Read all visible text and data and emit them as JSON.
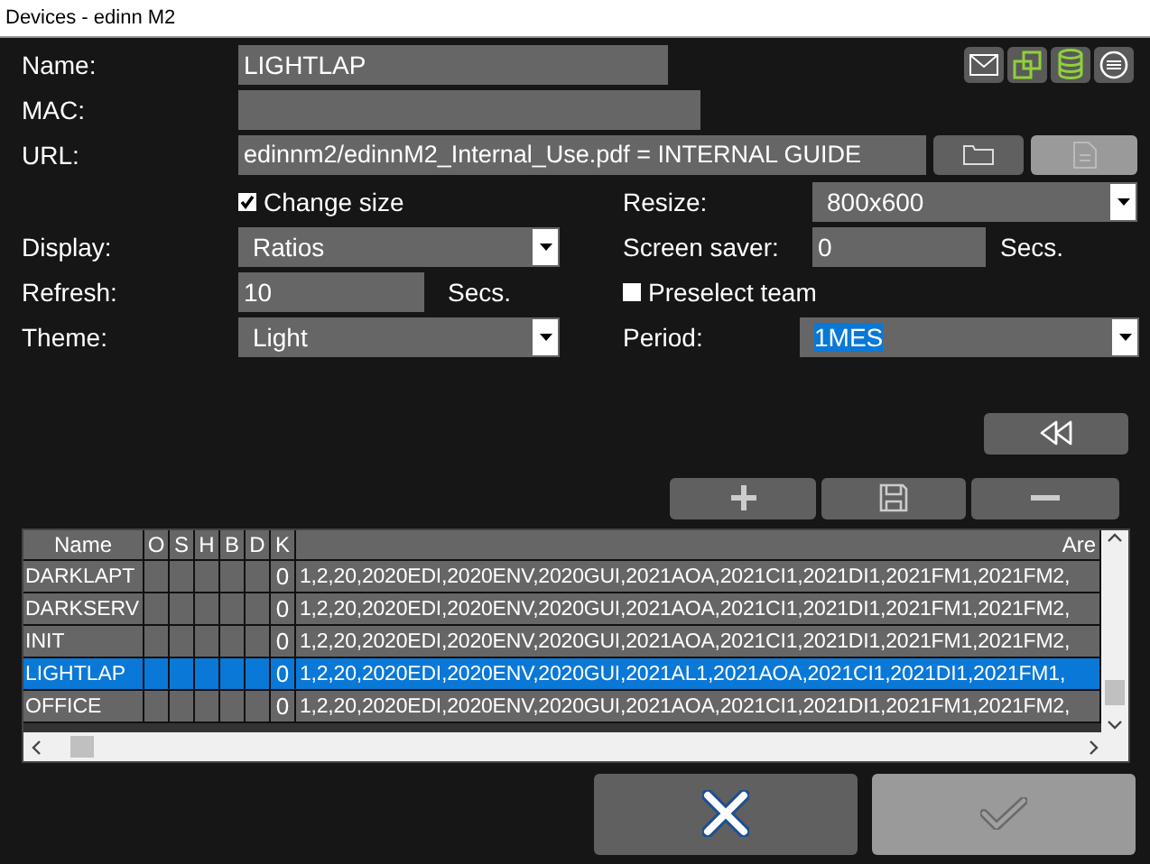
{
  "window": {
    "title": "Devices - edinn M2"
  },
  "form": {
    "name": {
      "label": "Name:",
      "value": "LIGHTLAP"
    },
    "mac": {
      "label": "MAC:"
    },
    "url": {
      "label": "URL:",
      "value": "edinnm2/edinnM2_Internal_Use.pdf = INTERNAL GUIDE"
    },
    "url_buttons": [
      {
        "kind": "folder",
        "disabled": false
      },
      {
        "kind": "document",
        "disabled": true
      }
    ],
    "change_size": {
      "label": "Change size",
      "checked": true
    },
    "resize": {
      "label": "Resize:",
      "value": "800x600"
    },
    "display": {
      "label": "Display:",
      "value": "Ratios"
    },
    "screen_saver": {
      "label": "Screen saver:",
      "value": "0",
      "unit": "Secs."
    },
    "refresh": {
      "label": "Refresh:",
      "value": "10",
      "unit": "Secs."
    },
    "preselect_team": {
      "label": "Preselect team",
      "checked": false
    },
    "theme": {
      "label": "Theme:",
      "value": "Light"
    },
    "period": {
      "label": "Period:",
      "value": "1MES",
      "highlighted": true
    }
  },
  "table": {
    "columns": [
      "Name",
      "O",
      "S",
      "H",
      "B",
      "D",
      "K",
      "Are"
    ],
    "rows": [
      {
        "cells": [
          "DARKLAPT",
          "",
          "",
          "",
          "",
          "",
          "0",
          "1,2,20,2020EDI,2020ENV,2020GUI,2021AOA,2021CI1,2021DI1,2021FM1,2021FM2,"
        ],
        "selected": false
      },
      {
        "cells": [
          "DARKSERV",
          "",
          "",
          "",
          "",
          "",
          "0",
          "1,2,20,2020EDI,2020ENV,2020GUI,2021AOA,2021CI1,2021DI1,2021FM1,2021FM2,"
        ],
        "selected": false
      },
      {
        "cells": [
          "INIT",
          "",
          "",
          "",
          "",
          "",
          "0",
          "1,2,20,2020EDI,2020ENV,2020GUI,2021AOA,2021CI1,2021DI1,2021FM1,2021FM2,"
        ],
        "selected": false
      },
      {
        "cells": [
          "LIGHTLAP",
          "",
          "",
          "",
          "",
          "",
          "0",
          "1,2,20,2020EDI,2020ENV,2020GUI,2021AL1,2021AOA,2021CI1,2021DI1,2021FM1,"
        ],
        "selected": true
      },
      {
        "cells": [
          "OFFICE",
          "",
          "",
          "",
          "",
          "",
          "0",
          "1,2,20,2020EDI,2020ENV,2020GUI,2021AOA,2021CI1,2021DI1,2021FM1,2021FM2,"
        ],
        "selected": false
      }
    ]
  },
  "dialog_buttons": [
    {
      "kind": "cancel",
      "disabled": false
    },
    {
      "kind": "ok",
      "disabled": true
    }
  ]
}
